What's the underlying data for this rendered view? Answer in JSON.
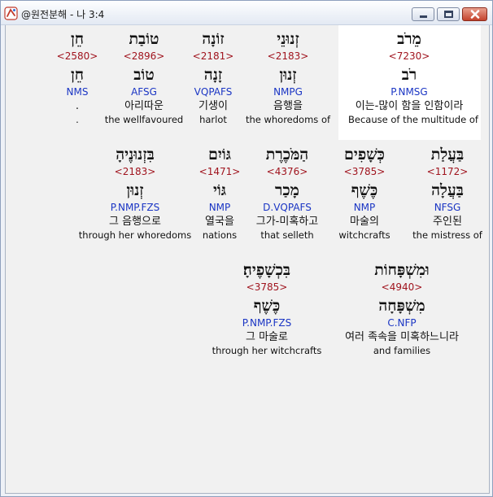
{
  "window": {
    "title": "@원전분해 - 나 3:4",
    "icon": "app-logo-icon",
    "buttons": [
      "minimize-icon",
      "maximize-icon",
      "close-icon"
    ]
  },
  "rows": [
    {
      "words": [
        {
          "hebrew": "מֵרֹב",
          "strong": "<7230>",
          "root": "רֹב",
          "morph": "P.NMSG",
          "korean": "이는-많이 함을 인함이라",
          "english": "Because of the multitude of"
        },
        {
          "hebrew": "זְנוּנֵי",
          "strong": "<2183>",
          "root": "זְנוּן",
          "morph": "NMPG",
          "korean": "음행을",
          "english": "the whoredoms of"
        },
        {
          "hebrew": "זוֹנָה",
          "strong": "<2181>",
          "root": "זָנָה",
          "morph": "VQPAFS",
          "korean": "기생이",
          "english": "harlot"
        },
        {
          "hebrew": "טוֹבַת",
          "strong": "<2896>",
          "root": "טוֹב",
          "morph": "AFSG",
          "korean": "아리따운",
          "english": "the wellfavoured"
        },
        {
          "hebrew": "חֵן",
          "strong": "<2580>",
          "root": "חֵן",
          "morph": "NMS",
          "korean": ".",
          "english": "."
        }
      ]
    },
    {
      "words": [
        {
          "hebrew": "בַּעֲלַת",
          "strong": "<1172>",
          "root": "בַּעֲלָה",
          "morph": "NFSG",
          "korean": "주인된",
          "english": "the mistress of"
        },
        {
          "hebrew": "כְּשָׁפִים",
          "strong": "<3785>",
          "root": "כֶּשֶׁף",
          "morph": "NMP",
          "korean": "마술의",
          "english": "witchcrafts"
        },
        {
          "hebrew": "הַמֹּכֶרֶת",
          "strong": "<4376>",
          "root": "מָכַר",
          "morph": "D.VQPAFS",
          "korean": "그가-미혹하고",
          "english": "that selleth"
        },
        {
          "hebrew": "גּוֹיִם",
          "strong": "<1471>",
          "root": "גּוֹי",
          "morph": "NMP",
          "korean": "열국을",
          "english": "nations"
        },
        {
          "hebrew": "בִּזְנוּנֶיהָ",
          "strong": "<2183>",
          "root": "זְנוּן",
          "morph": "P.NMP.FZS",
          "korean": "그 음행으로",
          "english": "through her whoredoms"
        }
      ]
    },
    {
      "words": [
        {
          "hebrew": "וּמִשְׁפָּחוֹת",
          "strong": "<4940>",
          "root": "מִשְׁפָּחָה",
          "morph": "C.NFP",
          "korean": "여러 족속을 미혹하느니라",
          "english": "and families"
        },
        {
          "hebrew": "בִּכְשָׁפֶיהָ׃",
          "strong": "<3785>",
          "root": "כֶּשֶׁף",
          "morph": "P.NMP.FZS",
          "korean": "그 마술로",
          "english": "through her witchcrafts"
        }
      ]
    }
  ]
}
